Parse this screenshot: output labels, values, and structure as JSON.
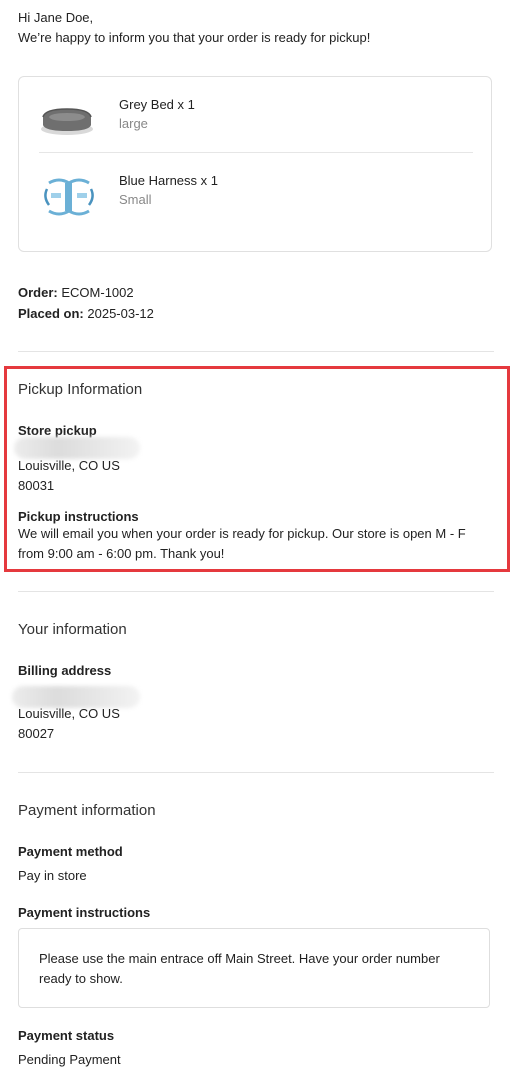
{
  "greeting": {
    "line1": "Hi Jane Doe,",
    "line2": "We’re happy to inform you that your order is ready for pickup!"
  },
  "items": [
    {
      "name": "Grey Bed x 1",
      "variant": "large",
      "icon": "grey-bed-thumbnail"
    },
    {
      "name": "Blue Harness x 1",
      "variant": "Small",
      "icon": "blue-harness-thumbnail"
    }
  ],
  "order": {
    "order_label": "Order:",
    "order_value": "ECOM-1002",
    "placed_label": "Placed on:",
    "placed_value": "2025-03-12"
  },
  "pickup": {
    "title": "Pickup Information",
    "store_label": "Store pickup",
    "city": "Louisville, CO US",
    "zip": "80031",
    "instructions_label": "Pickup instructions",
    "instructions": "We will email you when your order is ready for pickup. Our store is open M - F from 9:00 am - 6:00 pm. Thank you!"
  },
  "your_info": {
    "title": "Your information",
    "billing_label": "Billing address",
    "city": "Louisville, CO US",
    "zip": "80027"
  },
  "payment": {
    "title": "Payment information",
    "method_label": "Payment method",
    "method": "Pay in store",
    "instructions_label": "Payment instructions",
    "instructions": "Please use the main entrace off Main Street. Have your order number ready to show.",
    "status_label": "Payment status",
    "status": "Pending Payment"
  },
  "colors": {
    "highlight": "#e5393e",
    "muted": "#888888"
  }
}
